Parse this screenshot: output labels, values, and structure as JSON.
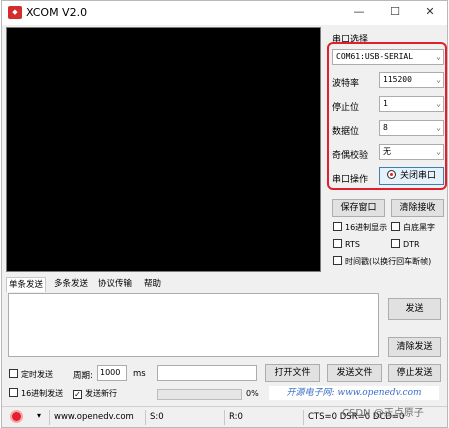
{
  "window": {
    "title": "XCOM V2.0",
    "logo_icon": "xcom-logo-icon",
    "minimize": "—",
    "maximize": "☐",
    "close": "✕"
  },
  "serial": {
    "group_label": "串口选择",
    "port": "COM61:USB-SERIAL",
    "baud_label": "波特率",
    "baud": "115200",
    "stopbits_label": "停止位",
    "stopbits": "1",
    "databits_label": "数据位",
    "databits": "8",
    "parity_label": "奇偶校验",
    "parity": "无",
    "operation_label": "串口操作",
    "close_port_button": "关闭串口",
    "highlight_color": "#e2202d"
  },
  "receive": {
    "save_window_button": "保存窗口",
    "clear_receive_button": "清除接收",
    "hex_display": "16进制显示",
    "white_bg_black": "白底黑字",
    "rts": "RTS",
    "dtr": "DTR",
    "timestamp": "时间戳(以换行回车断帧)"
  },
  "tabs": [
    "单条发送",
    "多条发送",
    "协议传输",
    "帮助"
  ],
  "send": {
    "send_button": "发送",
    "clear_send_button": "清除发送",
    "timed_send": "定时发送",
    "period_label": "周期:",
    "period_value": "1000",
    "period_unit": "ms",
    "open_file_button": "打开文件",
    "send_file_button": "发送文件",
    "stop_send_button": "停止发送",
    "hex_send": "16进制发送",
    "newline_send": "发送新行",
    "progress_percent": "0%",
    "progress_value": 0,
    "website_banner": "开源电子网: www.openedv.com"
  },
  "status": {
    "gear_icon": "gear-icon",
    "dropdown": "▾",
    "url": "www.openedv.com",
    "sent": "S:0",
    "received": "R:0",
    "lines": "CTS=0 DSR=0 DCD=0"
  },
  "watermark": "CSDN @正点原子"
}
